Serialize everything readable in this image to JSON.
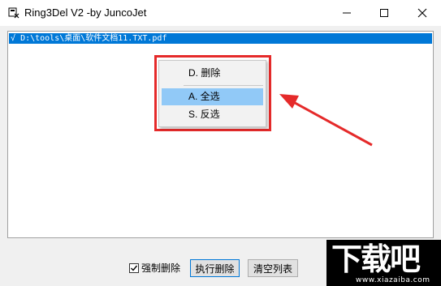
{
  "window": {
    "title": "Ring3Del V2 -by JuncoJet",
    "controls": [
      "minimize-icon",
      "maximize-icon",
      "close-icon"
    ]
  },
  "list": {
    "rows": [
      {
        "check": "√",
        "path": "D:\\tools\\桌面\\软件文档11.TXT.pdf",
        "selected": true
      }
    ]
  },
  "context_menu": {
    "items": [
      {
        "label": "D. 删除",
        "highlighted": false
      },
      {
        "label": "A. 全选",
        "highlighted": true
      },
      {
        "label": "S. 反选",
        "highlighted": false
      }
    ]
  },
  "bottom": {
    "force_delete_label": "强制删除",
    "force_delete_checked": true,
    "run_delete_label": "执行删除",
    "clear_list_label": "清空列表"
  },
  "watermark": {
    "big_text": "下载吧",
    "url_text": "www.xiazaiba.com"
  },
  "colors": {
    "selection": "#0078d7",
    "menu_highlight": "#91c9f7",
    "annotation": "#e52a2a"
  }
}
